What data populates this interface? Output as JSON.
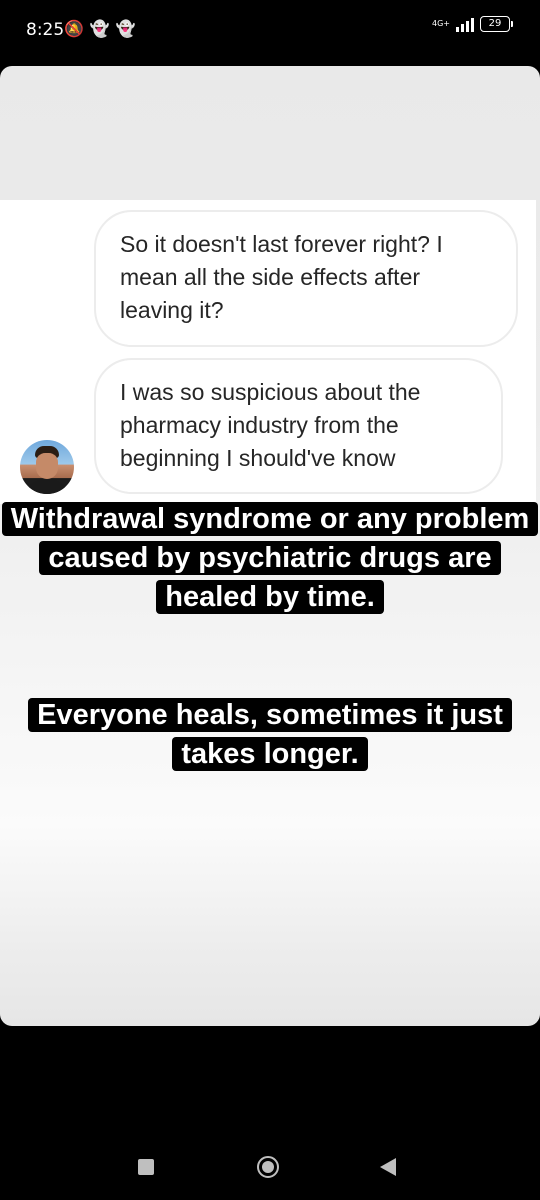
{
  "status_bar": {
    "time": "8:25",
    "icons_left": [
      "mute-icon",
      "snapchat-icon",
      "snapchat-icon"
    ],
    "network": "4G+",
    "battery": "29"
  },
  "chat": {
    "messages": [
      {
        "text": "So it doesn't last forever right? I mean all the side effects after leaving it?"
      },
      {
        "text": "I was so suspicious about the pharmacy industry from the beginning I should've know"
      }
    ]
  },
  "captions": [
    {
      "text": "Withdrawal syndrome or any problem caused by psychiatric drugs are healed by time."
    },
    {
      "text": "Everyone heals, sometimes it just takes longer."
    }
  ],
  "nav_bar": {
    "buttons": [
      "recents-icon",
      "home-icon",
      "back-icon"
    ]
  },
  "colors": {
    "background": "#000000",
    "card": "#ececec",
    "bubble_border": "#ececec",
    "caption_bg": "#000000",
    "caption_text": "#ffffff"
  }
}
